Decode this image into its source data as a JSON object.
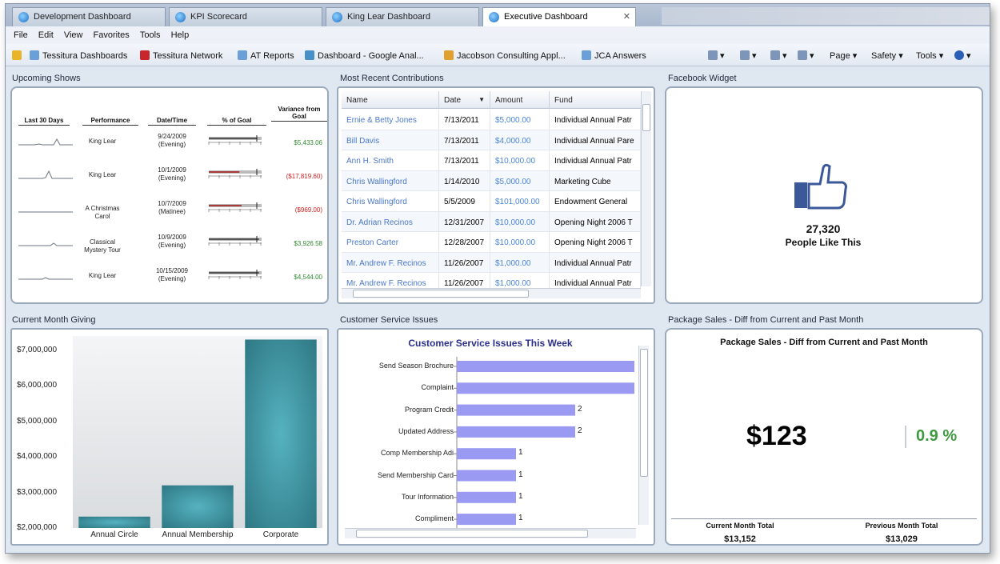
{
  "browser": {
    "tabs": [
      {
        "label": "Development Dashboard",
        "active": false
      },
      {
        "label": "KPI Scorecard",
        "active": false
      },
      {
        "label": "King Lear Dashboard",
        "active": false
      },
      {
        "label": "Executive Dashboard",
        "active": true
      }
    ],
    "menu": [
      "File",
      "Edit",
      "View",
      "Favorites",
      "Tools",
      "Help"
    ],
    "favorites": [
      "Tessitura Dashboards",
      "Tessitura Network",
      "AT Reports",
      "Dashboard - Google Anal...",
      "Jacobson Consulting Appl...",
      "JCA Answers"
    ],
    "commands": [
      "Page ▾",
      "Safety ▾",
      "Tools ▾"
    ]
  },
  "upcoming_shows": {
    "title": "Upcoming Shows",
    "headers": [
      "Last 30 Days",
      "Performance",
      "Date/Time",
      "% of Goal",
      "Variance from Goal"
    ],
    "rows": [
      {
        "performance": "King Lear",
        "date": "9/24/2009",
        "time": "(Evening)",
        "progress": 0.92,
        "variance": "$5,433.06",
        "negative": false
      },
      {
        "performance": "King Lear",
        "date": "10/1/2009",
        "time": "(Evening)",
        "progress": 0.58,
        "variance": "($17,819.60)",
        "negative": true
      },
      {
        "performance": "A Christmas Carol",
        "date": "10/7/2009",
        "time": "(Matinee)",
        "progress": 0.62,
        "variance": "($969.00)",
        "negative": true
      },
      {
        "performance": "Classical Mystery Tour",
        "date": "10/9/2009",
        "time": "(Evening)",
        "progress": 0.95,
        "variance": "$3,926.58",
        "negative": false
      },
      {
        "performance": "King Lear",
        "date": "10/15/2009",
        "time": "(Evening)",
        "progress": 0.95,
        "variance": "$4,544.00",
        "negative": false
      }
    ]
  },
  "contributions": {
    "title": "Most Recent Contributions",
    "columns": [
      "Name",
      "Date",
      "Amount",
      "Fund"
    ],
    "rows": [
      {
        "name": "Ernie & Betty Jones",
        "date": "7/13/2011",
        "amount": "$5,000.00",
        "fund": "Individual Annual Patr"
      },
      {
        "name": "Bill Davis",
        "date": "7/13/2011",
        "amount": "$4,000.00",
        "fund": "Individual Annual Pare"
      },
      {
        "name": "Ann H. Smith",
        "date": "7/13/2011",
        "amount": "$10,000.00",
        "fund": "Individual Annual Patr"
      },
      {
        "name": "Chris Wallingford",
        "date": "1/14/2010",
        "amount": "$5,000.00",
        "fund": "Marketing Cube"
      },
      {
        "name": "Chris Wallingford",
        "date": "5/5/2009",
        "amount": "$101,000.00",
        "fund": "Endowment General"
      },
      {
        "name": "Dr. Adrian Recinos",
        "date": "12/31/2007",
        "amount": "$10,000.00",
        "fund": "Opening Night 2006 T"
      },
      {
        "name": "Preston Carter",
        "date": "12/28/2007",
        "amount": "$10,000.00",
        "fund": "Opening Night 2006 T"
      },
      {
        "name": "Mr. Andrew F. Recinos",
        "date": "11/26/2007",
        "amount": "$1,000.00",
        "fund": "Individual Annual Patr"
      },
      {
        "name": "Mr. Andrew F. Recinos",
        "date": "11/26/2007",
        "amount": "$1,000.00",
        "fund": "Individual Annual Patr"
      }
    ]
  },
  "facebook": {
    "title": "Facebook Widget",
    "count": "27,320",
    "label": "People Like This"
  },
  "giving": {
    "title": "Current Month Giving",
    "chart_data": {
      "type": "bar",
      "categories": [
        "Annual Circle",
        "Annual Membership",
        "Corporate"
      ],
      "values": [
        2320000,
        3200000,
        7300000
      ],
      "ylim": [
        2000000,
        7400000
      ],
      "yticks": [
        "$7,000,000",
        "$6,000,000",
        "$5,000,000",
        "$4,000,000",
        "$3,000,000",
        "$2,000,000"
      ],
      "ytick_values": [
        7000000,
        6000000,
        5000000,
        4000000,
        3000000,
        2000000
      ],
      "color": "#3b8e9c"
    }
  },
  "service": {
    "title": "Customer Service Issues",
    "chart_data": {
      "type": "bar",
      "title": "Customer Service Issues This Week",
      "categories": [
        "Send Season Brochure",
        "Complaint",
        "Program Credit",
        "Updated Address",
        "Comp Membership Adi",
        "Send Membership Card",
        "Tour Information",
        "Compliment"
      ],
      "values": [
        3,
        3,
        2,
        2,
        1,
        1,
        1,
        1
      ],
      "value_labels": [
        "",
        "",
        "2",
        "2",
        "1",
        "1",
        "1",
        "1"
      ],
      "color": "#9a9af2"
    }
  },
  "package_sales": {
    "title": "Package Sales - Diff from Current and Past Month",
    "inner_title": "Package Sales - Diff from Current and Past Month",
    "value": "$123",
    "percent": "0.9 %",
    "current_label": "Current Month Total",
    "current_value": "$13,152",
    "previous_label": "Previous Month Total",
    "previous_value": "$13,029",
    "accent": "#3f9a3f"
  }
}
